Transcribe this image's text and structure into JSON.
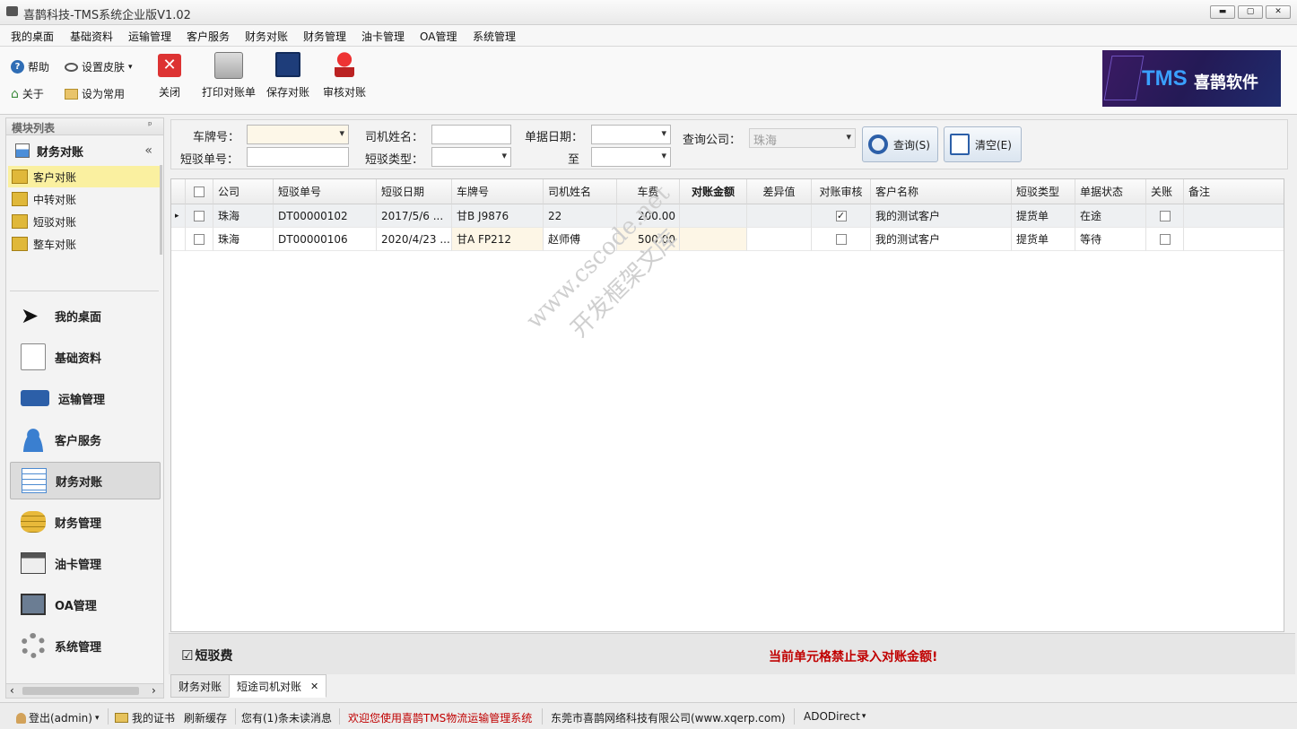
{
  "window": {
    "title": "喜鹊科技-TMS系统企业版V1.02",
    "min": "▬",
    "max": "▢",
    "close": "✕"
  },
  "menu": [
    "我的桌面",
    "基础资料",
    "运输管理",
    "客户服务",
    "财务对账",
    "财务管理",
    "油卡管理",
    "OA管理",
    "系统管理"
  ],
  "toolbar": {
    "help": "帮助",
    "skin": "设置皮肤",
    "about": "关于",
    "set_common": "设为常用",
    "close": "关闭",
    "print": "打印对账单",
    "save": "保存对账",
    "audit": "审核对账"
  },
  "logo": {
    "tms": "TMS",
    "name": "喜鹊软件"
  },
  "leftpanel": {
    "header": "模块列表",
    "pin": "ᵖ",
    "group_title": "财务对账",
    "collapse": "«",
    "sub_items": [
      "客户对账",
      "中转对账",
      "短驳对账",
      "整车对账"
    ],
    "nav": [
      "我的桌面",
      "基础资料",
      "运输管理",
      "客户服务",
      "财务对账",
      "财务管理",
      "油卡管理",
      "OA管理",
      "系统管理"
    ],
    "scroll_left": "‹",
    "scroll_right": "›"
  },
  "filter": {
    "plate_label": "车牌号：",
    "driver_label": "司机姓名：",
    "date_label": "单据日期：",
    "company_label": "查询公司：",
    "company_value": "珠海",
    "order_label": "短驳单号：",
    "type_label": "短驳类型：",
    "to_label": "至",
    "search_btn": "查询(S)",
    "clear_btn": "清空(E)"
  },
  "grid": {
    "columns": [
      "公司",
      "短驳单号",
      "短驳日期",
      "车牌号",
      "司机姓名",
      "车费",
      "对账金额",
      "差异值",
      "对账审核",
      "客户名称",
      "短驳类型",
      "单据状态",
      "关账",
      "备注"
    ],
    "rows": [
      {
        "company": "珠海",
        "order": "DT00000102",
        "date": "2017/5/6 ...",
        "plate": "甘B J9876",
        "driver": "22",
        "fee": "200.00",
        "amount": "",
        "diff": "",
        "audited": true,
        "customer": "我的测试客户",
        "type": "提货单",
        "status": "在途",
        "closed": false,
        "note": ""
      },
      {
        "company": "珠海",
        "order": "DT00000106",
        "date": "2020/4/23 ...",
        "plate": "甘A FP212",
        "driver": "赵师傅",
        "fee": "500.00",
        "amount": "",
        "diff": "",
        "audited": false,
        "customer": "我的测试客户",
        "type": "提货单",
        "status": "等待",
        "closed": false,
        "note": ""
      }
    ],
    "row_indicator": "▸"
  },
  "footer": {
    "check_label": "短驳费",
    "check_mark": "☑",
    "warning": "当前单元格禁止录入对账金额!"
  },
  "tabs": [
    {
      "label": "财务对账"
    },
    {
      "label": "短途司机对账",
      "close": "✕"
    }
  ],
  "watermark": {
    "line1": "www.cscode.net",
    "line2": "开发框架文库"
  },
  "status": {
    "logout": "登出(admin)",
    "cert": "我的证书",
    "refresh": "刷新缓存",
    "unread": "您有(1)条未读消息",
    "welcome": "欢迎您使用喜鹊TMS物流运输管理系统",
    "company": "东莞市喜鹊网络科技有限公司(www.xqerp.com)",
    "conn": "ADODirect"
  },
  "colors": {
    "warning": "#c00000",
    "welcome": "#c00000",
    "selected_sub": "#faf0a0"
  }
}
